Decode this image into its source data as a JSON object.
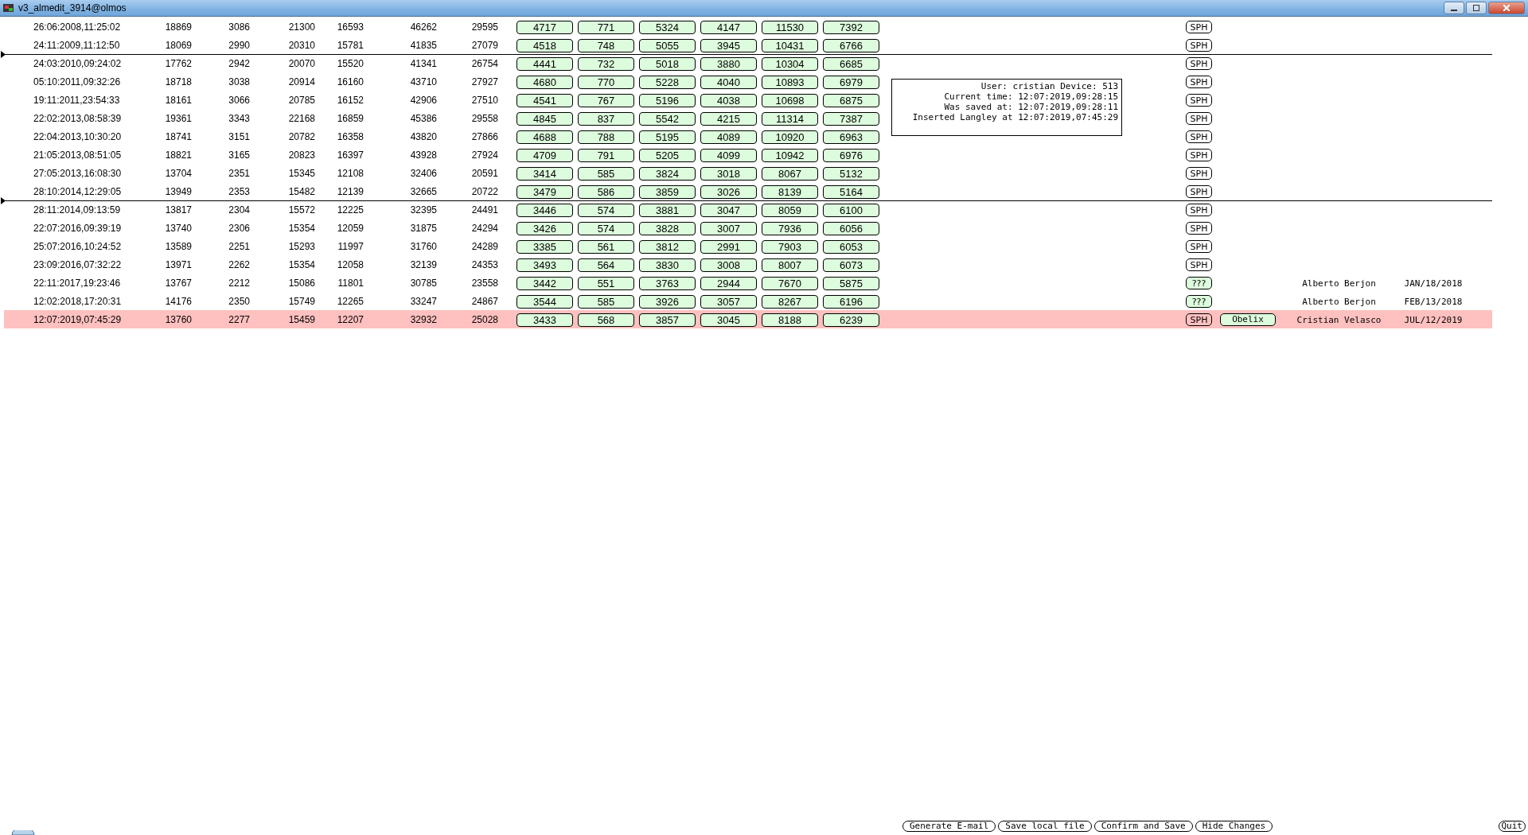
{
  "window": {
    "title": "v3_almedit_3914@olmos"
  },
  "rows": [
    {
      "time": "26:06:2008,11:25:02",
      "values": [
        "18869",
        "3086",
        "21300",
        "16593",
        "46262",
        "29595"
      ],
      "edits": [
        "4717",
        "771",
        "5324",
        "4147",
        "11530",
        "7392"
      ],
      "flag": {
        "label": "SPH",
        "kind": "plain"
      },
      "divider_above": false,
      "selected": false
    },
    {
      "time": "24:11:2009,11:12:50",
      "values": [
        "18069",
        "2990",
        "20310",
        "15781",
        "41835",
        "27079"
      ],
      "edits": [
        "4518",
        "748",
        "5055",
        "3945",
        "10431",
        "6766"
      ],
      "flag": {
        "label": "SPH",
        "kind": "plain"
      },
      "divider_above": false,
      "selected": false
    },
    {
      "time": "24:03:2010,09:24:02",
      "values": [
        "17762",
        "2942",
        "20070",
        "15520",
        "41341",
        "26754"
      ],
      "edits": [
        "4441",
        "732",
        "5018",
        "3880",
        "10304",
        "6685"
      ],
      "flag": {
        "label": "SPH",
        "kind": "plain"
      },
      "divider_above": true,
      "selected": false
    },
    {
      "time": "05:10:2011,09:32:26",
      "values": [
        "18718",
        "3038",
        "20914",
        "16160",
        "43710",
        "27927"
      ],
      "edits": [
        "4680",
        "770",
        "5228",
        "4040",
        "10893",
        "6979"
      ],
      "flag": {
        "label": "SPH",
        "kind": "plain"
      },
      "divider_above": false,
      "selected": false
    },
    {
      "time": "19:11:2011,23:54:33",
      "values": [
        "18161",
        "3066",
        "20785",
        "16152",
        "42906",
        "27510"
      ],
      "edits": [
        "4541",
        "767",
        "5196",
        "4038",
        "10698",
        "6875"
      ],
      "flag": {
        "label": "SPH",
        "kind": "plain"
      },
      "divider_above": false,
      "selected": false
    },
    {
      "time": "22:02:2013,08:58:39",
      "values": [
        "19361",
        "3343",
        "22168",
        "16859",
        "45386",
        "29558"
      ],
      "edits": [
        "4845",
        "837",
        "5542",
        "4215",
        "11314",
        "7387"
      ],
      "flag": {
        "label": "SPH",
        "kind": "plain"
      },
      "divider_above": false,
      "selected": false
    },
    {
      "time": "22:04:2013,10:30:20",
      "values": [
        "18741",
        "3151",
        "20782",
        "16358",
        "43820",
        "27866"
      ],
      "edits": [
        "4688",
        "788",
        "5195",
        "4089",
        "10920",
        "6963"
      ],
      "flag": {
        "label": "SPH",
        "kind": "plain"
      },
      "divider_above": false,
      "selected": false
    },
    {
      "time": "21:05:2013,08:51:05",
      "values": [
        "18821",
        "3165",
        "20823",
        "16397",
        "43928",
        "27924"
      ],
      "edits": [
        "4709",
        "791",
        "5205",
        "4099",
        "10942",
        "6976"
      ],
      "flag": {
        "label": "SPH",
        "kind": "plain"
      },
      "divider_above": false,
      "selected": false
    },
    {
      "time": "27:05:2013,16:08:30",
      "values": [
        "13704",
        "2351",
        "15345",
        "12108",
        "32406",
        "20591"
      ],
      "edits": [
        "3414",
        "585",
        "3824",
        "3018",
        "8067",
        "5132"
      ],
      "flag": {
        "label": "SPH",
        "kind": "plain"
      },
      "divider_above": false,
      "selected": false
    },
    {
      "time": "28:10:2014,12:29:05",
      "values": [
        "13949",
        "2353",
        "15482",
        "12139",
        "32665",
        "20722"
      ],
      "edits": [
        "3479",
        "586",
        "3859",
        "3026",
        "8139",
        "5164"
      ],
      "flag": {
        "label": "SPH",
        "kind": "plain"
      },
      "divider_above": false,
      "selected": false
    },
    {
      "time": "28:11:2014,09:13:59",
      "values": [
        "13817",
        "2304",
        "15572",
        "12225",
        "32395",
        "24491"
      ],
      "edits": [
        "3446",
        "574",
        "3881",
        "3047",
        "8059",
        "6100"
      ],
      "flag": {
        "label": "SPH",
        "kind": "plain"
      },
      "divider_above": true,
      "selected": false
    },
    {
      "time": "22:07:2016,09:39:19",
      "values": [
        "13740",
        "2306",
        "15354",
        "12059",
        "31875",
        "24294"
      ],
      "edits": [
        "3426",
        "574",
        "3828",
        "3007",
        "7936",
        "6056"
      ],
      "flag": {
        "label": "SPH",
        "kind": "plain"
      },
      "divider_above": false,
      "selected": false
    },
    {
      "time": "25:07:2016,10:24:52",
      "values": [
        "13589",
        "2251",
        "15293",
        "11997",
        "31760",
        "24289"
      ],
      "edits": [
        "3385",
        "561",
        "3812",
        "2991",
        "7903",
        "6053"
      ],
      "flag": {
        "label": "SPH",
        "kind": "plain"
      },
      "divider_above": false,
      "selected": false
    },
    {
      "time": "23:09:2016,07:32:22",
      "values": [
        "13971",
        "2262",
        "15354",
        "12058",
        "32139",
        "24353"
      ],
      "edits": [
        "3493",
        "564",
        "3830",
        "3008",
        "8007",
        "6073"
      ],
      "flag": {
        "label": "SPH",
        "kind": "plain"
      },
      "divider_above": false,
      "selected": false
    },
    {
      "time": "22:11:2017,19:23:46",
      "values": [
        "13767",
        "2212",
        "15086",
        "11801",
        "30785",
        "23558"
      ],
      "edits": [
        "3442",
        "551",
        "3763",
        "2944",
        "7670",
        "5875"
      ],
      "flag": {
        "label": "???",
        "kind": "filled"
      },
      "user": "Alberto Berjon",
      "date": "JAN/18/2018",
      "divider_above": false,
      "selected": false
    },
    {
      "time": "12:02:2018,17:20:31",
      "values": [
        "14176",
        "2350",
        "15749",
        "12265",
        "33247",
        "24867"
      ],
      "edits": [
        "3544",
        "585",
        "3926",
        "3057",
        "8267",
        "6196"
      ],
      "flag": {
        "label": "???",
        "kind": "filled"
      },
      "user": "Alberto Berjon",
      "date": "FEB/13/2018",
      "divider_above": false,
      "selected": false
    },
    {
      "time": "12:07:2019,07:45:29",
      "values": [
        "13760",
        "2277",
        "15459",
        "12207",
        "32932",
        "25028"
      ],
      "edits": [
        "3433",
        "568",
        "3857",
        "3045",
        "8188",
        "6239"
      ],
      "flag": {
        "label": "SPH",
        "kind": "plain"
      },
      "tag": "Obelix",
      "user": "Cristian Velasco",
      "date": "JUL/12/2019",
      "divider_above": false,
      "selected": true
    }
  ],
  "info": [
    "User: cristian Device: 513",
    "Current time: 12:07:2019,09:28:15",
    "Was saved at: 12:07:2019,09:28:11",
    "Inserted Langley at 12:07:2019,07:45:29"
  ],
  "buttons": [
    "Generate E-mail",
    "Save local file",
    "Confirm and Save",
    "Hide Changes"
  ],
  "quit": "Quit"
}
